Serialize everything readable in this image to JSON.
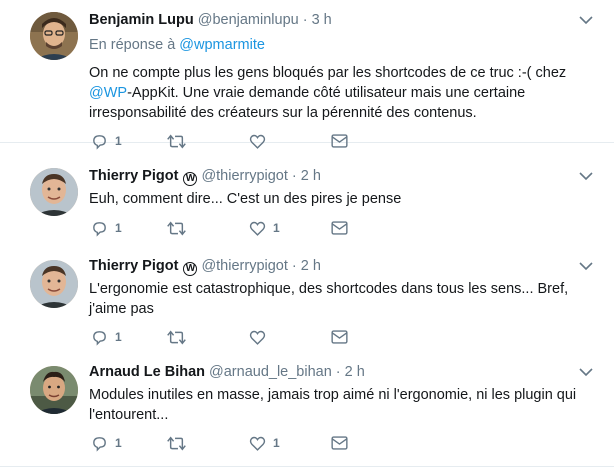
{
  "tweets": [
    {
      "fullname": "Benjamin Lupu",
      "verified_badge": "",
      "username": "@benjaminlupu",
      "separator": "·",
      "time": "3 h",
      "reply_prefix": "En réponse à",
      "reply_mention": "@wpmarmite",
      "text_before_mention": "On ne compte plus les gens bloqués par les shortcodes de ce truc :-( chez",
      "mention": "@WP",
      "text_after_mention": "-AppKit. Une vraie demande côté utilisateur mais une certaine irresponsabilité des créateurs sur la pérennité des contenus.",
      "reply_count": "1",
      "retweet_count": "",
      "like_count": ""
    },
    {
      "fullname": "Thierry Pigot",
      "verified_badge": "W",
      "username": "@thierrypigot",
      "separator": "·",
      "time": "2 h",
      "text": "Euh, comment dire... C'est un des pires je pense",
      "reply_count": "1",
      "retweet_count": "",
      "like_count": "1"
    },
    {
      "fullname": "Thierry Pigot",
      "verified_badge": "W",
      "username": "@thierrypigot",
      "separator": "·",
      "time": "2 h",
      "text": "L'ergonomie est catastrophique, des shortcodes dans tous les sens... Bref, j'aime pas",
      "reply_count": "1",
      "retweet_count": "",
      "like_count": ""
    },
    {
      "fullname": "Arnaud Le Bihan",
      "verified_badge": "",
      "username": "@arnaud_le_bihan",
      "separator": "·",
      "time": "2 h",
      "text": "Modules inutiles en masse, jamais trop aimé ni l'ergonomie, ni les plugin qui l'entourent...",
      "reply_count": "1",
      "retweet_count": "",
      "like_count": "1"
    }
  ],
  "icons": {
    "reply": "reply-icon",
    "retweet": "retweet-icon",
    "like": "heart-icon",
    "dm": "envelope-icon",
    "more": "chevron-down-icon"
  },
  "colors": {
    "text": "#14171a",
    "muted": "#657786",
    "link": "#1b95e0",
    "border": "#e6ecf0"
  }
}
